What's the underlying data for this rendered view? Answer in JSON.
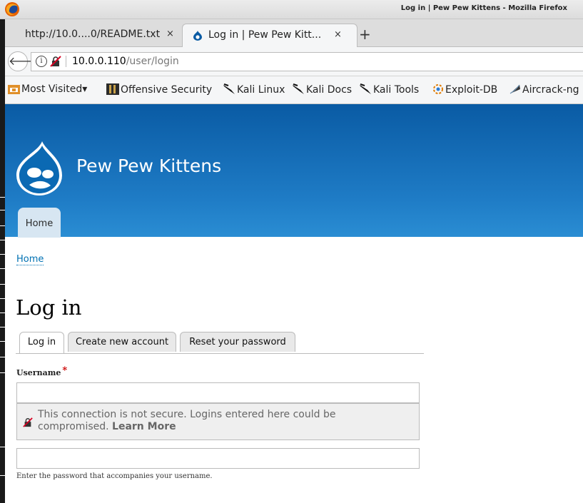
{
  "window": {
    "title": "Log in | Pew Pew Kittens - Mozilla Firefox"
  },
  "tabs": [
    {
      "label": "http://10.0....0/README.txt",
      "close": "×"
    },
    {
      "label": "Log in | Pew Pew Kitt...",
      "close": "×"
    }
  ],
  "new_tab_label": "+",
  "navbar": {
    "back_glyph": "🡐",
    "info_glyph": "i",
    "url_host": "10.0.0.110",
    "url_path": "/user/login"
  },
  "bookmarks": [
    {
      "label": "Most Visited",
      "suffix": "▾"
    },
    {
      "label": "Offensive Security"
    },
    {
      "label": "Kali Linux"
    },
    {
      "label": "Kali Docs"
    },
    {
      "label": "Kali Tools"
    },
    {
      "label": "Exploit-DB"
    },
    {
      "label": "Aircrack-ng"
    }
  ],
  "site": {
    "name": "Pew Pew Kittens",
    "nav_home": "Home"
  },
  "breadcrumb": "Home",
  "page_title": "Log in",
  "page_tabs": [
    {
      "label": "Log in",
      "active": true
    },
    {
      "label": "Create new account",
      "active": false
    },
    {
      "label": "Reset your password",
      "active": false
    }
  ],
  "form": {
    "username_label": "Username",
    "required_mark": "*",
    "username_value": "",
    "password_value": "",
    "password_description": "Enter the password that accompanies your username."
  },
  "insecure_warning": {
    "message": "This connection is not secure. Logins entered here could be compromised.",
    "learn_more": "Learn More"
  },
  "colors": {
    "header_top": "#0a5ba4",
    "header_bottom": "#2a8dd3",
    "link": "#0071b3",
    "required": "#cc0000"
  }
}
